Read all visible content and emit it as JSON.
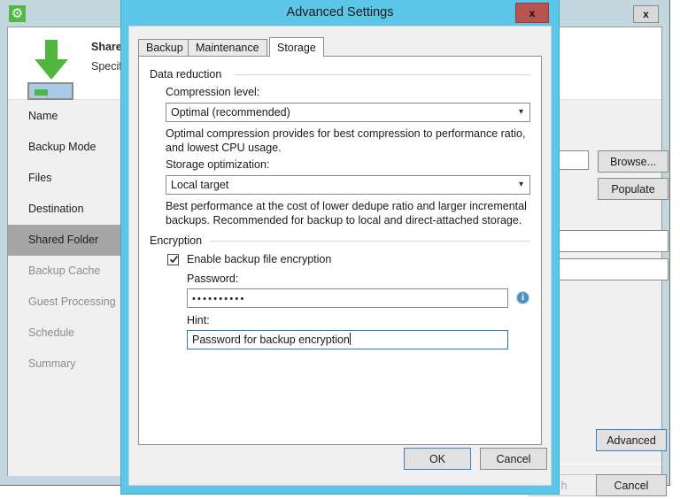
{
  "background_window": {
    "title_icon": "gear-icon",
    "close_label": "x",
    "header": {
      "title": "Shared F",
      "subtitle": "Specify a"
    },
    "sidebar": {
      "items": [
        {
          "label": "Name",
          "state": "done"
        },
        {
          "label": "Backup Mode",
          "state": "done"
        },
        {
          "label": "Files",
          "state": "done"
        },
        {
          "label": "Destination",
          "state": "done"
        },
        {
          "label": "Shared Folder",
          "state": "active"
        },
        {
          "label": "Backup Cache",
          "state": "pending"
        },
        {
          "label": "Guest Processing",
          "state": "pending"
        },
        {
          "label": "Schedule",
          "state": "pending"
        },
        {
          "label": "Summary",
          "state": "pending"
        }
      ]
    },
    "buttons": {
      "browse": "Browse...",
      "populate": "Populate",
      "advanced": "Advanced",
      "finish": "h",
      "cancel": "Cancel"
    }
  },
  "dialog": {
    "title": "Advanced Settings",
    "close_label": "x",
    "tabs": [
      {
        "label": "Backup",
        "active": false
      },
      {
        "label": "Maintenance",
        "active": false
      },
      {
        "label": "Storage",
        "active": true
      }
    ],
    "storage": {
      "data_reduction": {
        "group_label": "Data reduction",
        "compression_label": "Compression level:",
        "compression_value": "Optimal (recommended)",
        "compression_desc": "Optimal compression provides for best compression to performance ratio, and lowest CPU usage.",
        "storage_opt_label": "Storage optimization:",
        "storage_opt_value": "Local target",
        "storage_opt_desc": "Best performance at the cost of lower dedupe ratio and larger incremental backups. Recommended for backup to local and direct-attached storage."
      },
      "encryption": {
        "group_label": "Encryption",
        "enable_label": "Enable backup file encryption",
        "enable_checked": true,
        "password_label": "Password:",
        "password_value": "••••••••••",
        "password_info_icon": "info-icon",
        "hint_label": "Hint:",
        "hint_value": "Password for backup encryption"
      }
    },
    "footer": {
      "ok": "OK",
      "cancel": "Cancel"
    }
  },
  "colors": {
    "dialog_chrome": "#5bc6e8",
    "close_red": "#b85450",
    "accent_green": "#51b63f",
    "focus_blue": "#2b7ab8",
    "sidebar_active": "#a6a6a6"
  }
}
